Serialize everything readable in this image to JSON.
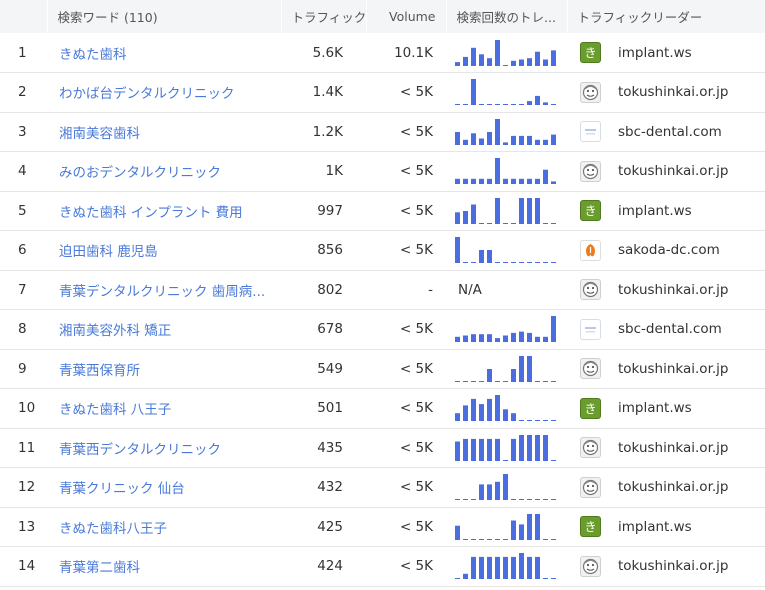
{
  "header": {
    "keyword": "検索ワード (110)",
    "traffic": "トラフィック",
    "volume": "Volume",
    "trend": "検索回数のトレ...",
    "leader": "トラフィックリーダー"
  },
  "colors": {
    "bar": "#4a6ee0",
    "link": "#4a7ad8"
  },
  "rows": [
    {
      "rank": "1",
      "keyword": "きぬた歯科",
      "traffic": "5.6K",
      "volume": "10.1K",
      "trend": [
        0.15,
        0.35,
        0.7,
        0.45,
        0.3,
        1.0,
        0,
        0.2,
        0.25,
        0.3,
        0.55,
        0.25,
        0.6
      ],
      "leader_icon": "implant-favicon",
      "leader_glyph": "き",
      "leader": "implant.ws"
    },
    {
      "rank": "2",
      "keyword": "わかば台デンタルクリニック",
      "traffic": "1.4K",
      "volume": "< 5K",
      "trend": [
        0,
        0,
        1.0,
        0,
        0,
        0,
        0,
        0,
        0,
        0.15,
        0.35,
        0.1,
        0
      ],
      "leader_icon": "tokushinkai-favicon",
      "leader_glyph": "",
      "leader": "tokushinkai.or.jp"
    },
    {
      "rank": "3",
      "keyword": "湘南美容歯科",
      "traffic": "1.2K",
      "volume": "< 5K",
      "trend": [
        0.5,
        0.2,
        0.45,
        0.25,
        0.5,
        1.0,
        0.1,
        0.35,
        0.35,
        0.35,
        0.2,
        0.2,
        0.4
      ],
      "leader_icon": "sbc-favicon",
      "leader_glyph": "",
      "leader": "sbc-dental.com"
    },
    {
      "rank": "4",
      "keyword": "みのおデンタルクリニック",
      "traffic": "1K",
      "volume": "< 5K",
      "trend": [
        0.2,
        0.2,
        0.2,
        0.2,
        0.2,
        1.0,
        0.2,
        0.2,
        0.2,
        0.2,
        0.2,
        0.55,
        0.1
      ],
      "leader_icon": "tokushinkai-favicon",
      "leader_glyph": "",
      "leader": "tokushinkai.or.jp"
    },
    {
      "rank": "5",
      "keyword": "きぬた歯科 インプラント 費用",
      "traffic": "997",
      "volume": "< 5K",
      "trend": [
        0.45,
        0.5,
        0.75,
        0,
        0,
        1.0,
        0,
        0,
        1.0,
        1.0,
        1.0,
        0,
        0
      ],
      "leader_icon": "implant-favicon",
      "leader_glyph": "き",
      "leader": "implant.ws"
    },
    {
      "rank": "6",
      "keyword": "迫田歯科 鹿児島",
      "traffic": "856",
      "volume": "< 5K",
      "trend": [
        1.0,
        0,
        0,
        0.5,
        0.5,
        0,
        0,
        0,
        0,
        0,
        0,
        0,
        0
      ],
      "leader_icon": "sakoda-favicon",
      "leader_glyph": "",
      "leader": "sakoda-dc.com"
    },
    {
      "rank": "7",
      "keyword": "青葉デンタルクリニック 歯周病...",
      "traffic": "802",
      "volume": "-",
      "trend": null,
      "trend_na": "N/A",
      "leader_icon": "tokushinkai-favicon",
      "leader_glyph": "",
      "leader": "tokushinkai.or.jp"
    },
    {
      "rank": "8",
      "keyword": "湘南美容外科 矯正",
      "traffic": "678",
      "volume": "< 5K",
      "trend": [
        0.2,
        0.25,
        0.3,
        0.3,
        0.3,
        0.15,
        0.25,
        0.35,
        0.4,
        0.35,
        0.2,
        0.2,
        1.0
      ],
      "leader_icon": "sbc-favicon",
      "leader_glyph": "",
      "leader": "sbc-dental.com"
    },
    {
      "rank": "9",
      "keyword": "青葉西保育所",
      "traffic": "549",
      "volume": "< 5K",
      "trend": [
        0,
        0,
        0,
        0,
        0.5,
        0,
        0,
        0.5,
        1.0,
        1.0,
        0,
        0,
        0
      ],
      "leader_icon": "tokushinkai-favicon",
      "leader_glyph": "",
      "leader": "tokushinkai.or.jp"
    },
    {
      "rank": "10",
      "keyword": "きぬた歯科 八王子",
      "traffic": "501",
      "volume": "< 5K",
      "trend": [
        0.3,
        0.6,
        0.85,
        0.65,
        0.85,
        1.0,
        0.45,
        0.3,
        0,
        0,
        0,
        0,
        0
      ],
      "leader_icon": "implant-favicon",
      "leader_glyph": "き",
      "leader": "implant.ws"
    },
    {
      "rank": "11",
      "keyword": "青葉西デンタルクリニック",
      "traffic": "435",
      "volume": "< 5K",
      "trend": [
        0.75,
        0.85,
        0.85,
        0.85,
        0.85,
        0.85,
        0,
        0.85,
        1.0,
        1.0,
        1.0,
        1.0,
        0
      ],
      "leader_icon": "tokushinkai-favicon",
      "leader_glyph": "",
      "leader": "tokushinkai.or.jp"
    },
    {
      "rank": "12",
      "keyword": "青葉クリニック 仙台",
      "traffic": "432",
      "volume": "< 5K",
      "trend": [
        0,
        0,
        0,
        0.6,
        0.6,
        0.7,
        1.0,
        0,
        0,
        0,
        0,
        0,
        0
      ],
      "leader_icon": "tokushinkai-favicon",
      "leader_glyph": "",
      "leader": "tokushinkai.or.jp"
    },
    {
      "rank": "13",
      "keyword": "きぬた歯科八王子",
      "traffic": "425",
      "volume": "< 5K",
      "trend": [
        0.55,
        0,
        0,
        0,
        0,
        0,
        0,
        0.75,
        0.6,
        1.0,
        1.0,
        0,
        0
      ],
      "leader_icon": "implant-favicon",
      "leader_glyph": "き",
      "leader": "implant.ws"
    },
    {
      "rank": "14",
      "keyword": "青葉第二歯科",
      "traffic": "424",
      "volume": "< 5K",
      "trend": [
        0,
        0.2,
        0.85,
        0.85,
        0.85,
        0.85,
        0.85,
        0.85,
        1.0,
        0.85,
        0.85,
        0,
        0
      ],
      "leader_icon": "tokushinkai-favicon",
      "leader_glyph": "",
      "leader": "tokushinkai.or.jp"
    }
  ]
}
